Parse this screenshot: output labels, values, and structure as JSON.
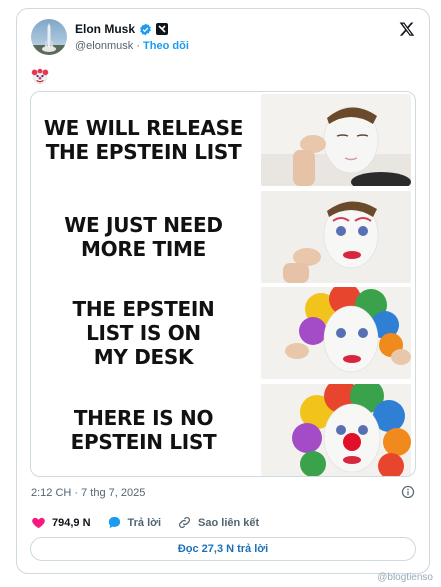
{
  "author": {
    "display_name": "Elon Musk",
    "handle": "@elonmusk",
    "separator": "·",
    "follow_label": "Theo dõi"
  },
  "icons": {
    "verified": "verified-badge-icon",
    "affiliate": "affiliate-badge-icon",
    "x_logo": "x-logo-icon",
    "info": "info-icon",
    "like": "heart-icon",
    "reply": "reply-bubble-icon",
    "copy_link": "link-icon",
    "emoji": "clown-face-emoji"
  },
  "meme": {
    "panels": [
      {
        "caption": "WE WILL RELEASE\nTHE EPSTEIN LIST"
      },
      {
        "caption": "WE JUST NEED\nMORE TIME"
      },
      {
        "caption": "THE EPSTEIN\nLIST IS ON\nMY DESK"
      },
      {
        "caption": "THERE IS NO\nEPSTEIN LIST"
      }
    ]
  },
  "timestamp": "2:12 CH · 7 thg 7, 2025",
  "actions": {
    "likes": "794,9 N",
    "reply_label": "Trả lời",
    "copy_link_label": "Sao liên kết"
  },
  "read_replies_label": "Đọc 27,3 N trả lời",
  "watermark": "@blogtienso",
  "colors": {
    "accent": "#1d9bf0",
    "like": "#f91880",
    "border": "#cfd9de",
    "muted_text": "#536471"
  }
}
